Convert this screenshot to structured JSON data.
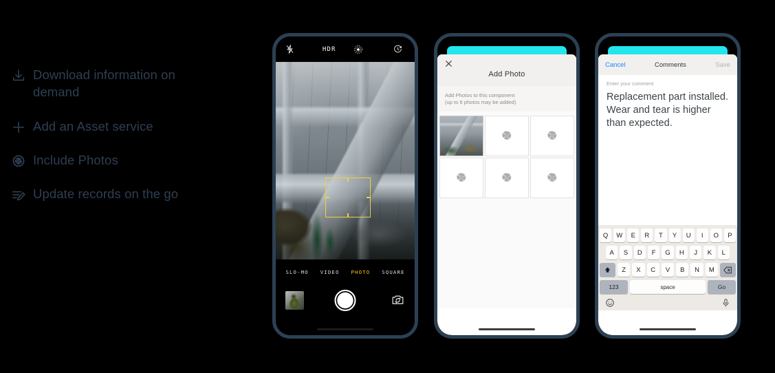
{
  "features": [
    {
      "icon": "download-icon",
      "label": "Download information on demand"
    },
    {
      "icon": "plus-icon",
      "label": "Add an Asset service"
    },
    {
      "icon": "camera-aperture-icon",
      "label": "Include Photos"
    },
    {
      "icon": "list-edit-icon",
      "label": "Update records on the go"
    }
  ],
  "colors": {
    "text_slate": "#2e3f52",
    "phone_bezel": "#2c4153",
    "accent_cyan": "#22e5ee",
    "focus_yellow": "#ecd33f",
    "active_mode_yellow": "#f5c518",
    "link_blue": "#1b87f7",
    "disabled_grey": "#b0b3b5"
  },
  "phone1": {
    "name": "camera-capture-screen",
    "topbar": {
      "flash_icon": "flash-off-icon",
      "hdr_label": "HDR",
      "live_photo_icon": "live-photo-icon",
      "timer_icon": "timer-icon"
    },
    "viewfinder": {
      "subject": "industrial HVAC ductwork with technician in gloves",
      "focus_box": "autofocus-rectangle"
    },
    "modes": [
      {
        "label": "SLO-MO",
        "active": false
      },
      {
        "label": "VIDEO",
        "active": false
      },
      {
        "label": "PHOTO",
        "active": true
      },
      {
        "label": "SQUARE",
        "active": false
      }
    ],
    "actions": {
      "thumbnail": "last-photo-thumbnail",
      "shutter": "shutter-button",
      "flip_icon": "flip-camera-icon"
    }
  },
  "phone2": {
    "name": "add-photo-sheet",
    "close_icon": "close-icon",
    "title": "Add Photo",
    "instructions_line1": "Add Photos to this component",
    "instructions_line2": "(up to 6 photos may be added)",
    "max_photos": 6,
    "cells": [
      {
        "filled": true,
        "icon": null
      },
      {
        "filled": false,
        "icon": "camera-aperture-icon"
      },
      {
        "filled": false,
        "icon": "camera-aperture-icon"
      },
      {
        "filled": false,
        "icon": "camera-aperture-icon"
      },
      {
        "filled": false,
        "icon": "camera-aperture-icon"
      },
      {
        "filled": false,
        "icon": "camera-aperture-icon"
      }
    ]
  },
  "phone3": {
    "name": "comments-entry-screen",
    "cancel_label": "Cancel",
    "title": "Comments",
    "save_label": "Save",
    "field_placeholder": "Enter your comment",
    "field_value": "Replacement part installed. Wear and tear is higher than expected.",
    "keyboard": {
      "row1": [
        "Q",
        "W",
        "E",
        "R",
        "T",
        "Y",
        "U",
        "I",
        "O",
        "P"
      ],
      "row2": [
        "A",
        "S",
        "D",
        "F",
        "G",
        "H",
        "J",
        "K",
        "L"
      ],
      "row3_letters": [
        "Z",
        "X",
        "C",
        "V",
        "B",
        "N",
        "M"
      ],
      "shift_icon": "shift-icon",
      "backspace_icon": "backspace-icon",
      "numbers_label": "123",
      "space_label": "space",
      "return_label": "Go",
      "emoji_icon": "emoji-icon",
      "mic_icon": "microphone-icon"
    }
  }
}
